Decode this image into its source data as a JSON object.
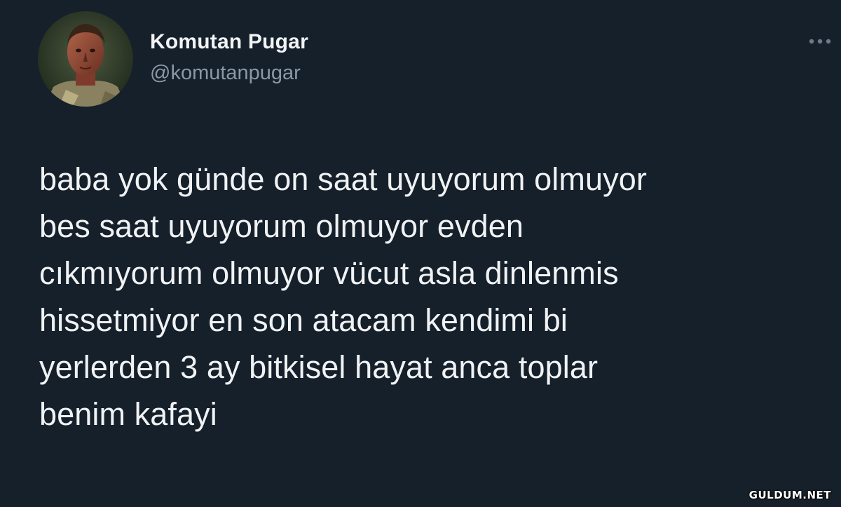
{
  "author": {
    "display_name": "Komutan Pugar",
    "handle": "@komutanpugar",
    "avatar_icon": "avatar-portrait-icon"
  },
  "more_icon": "more-options-icon",
  "tweet": {
    "lines": [
      "baba yok günde on saat uyuyorum olmuyor",
      "bes saat uyuyorum olmuyor evden",
      "cıkmıyorum olmuyor vücut asla dinlenmis",
      "hissetmiyor en son atacam kendimi bi",
      "yerlerden 3 ay bitkisel hayat anca toplar",
      "benim kafayi"
    ]
  },
  "watermark": "GULDUM.NET",
  "colors": {
    "background": "#15202b",
    "text": "#e7e9ea",
    "secondary": "#8b98a5"
  }
}
